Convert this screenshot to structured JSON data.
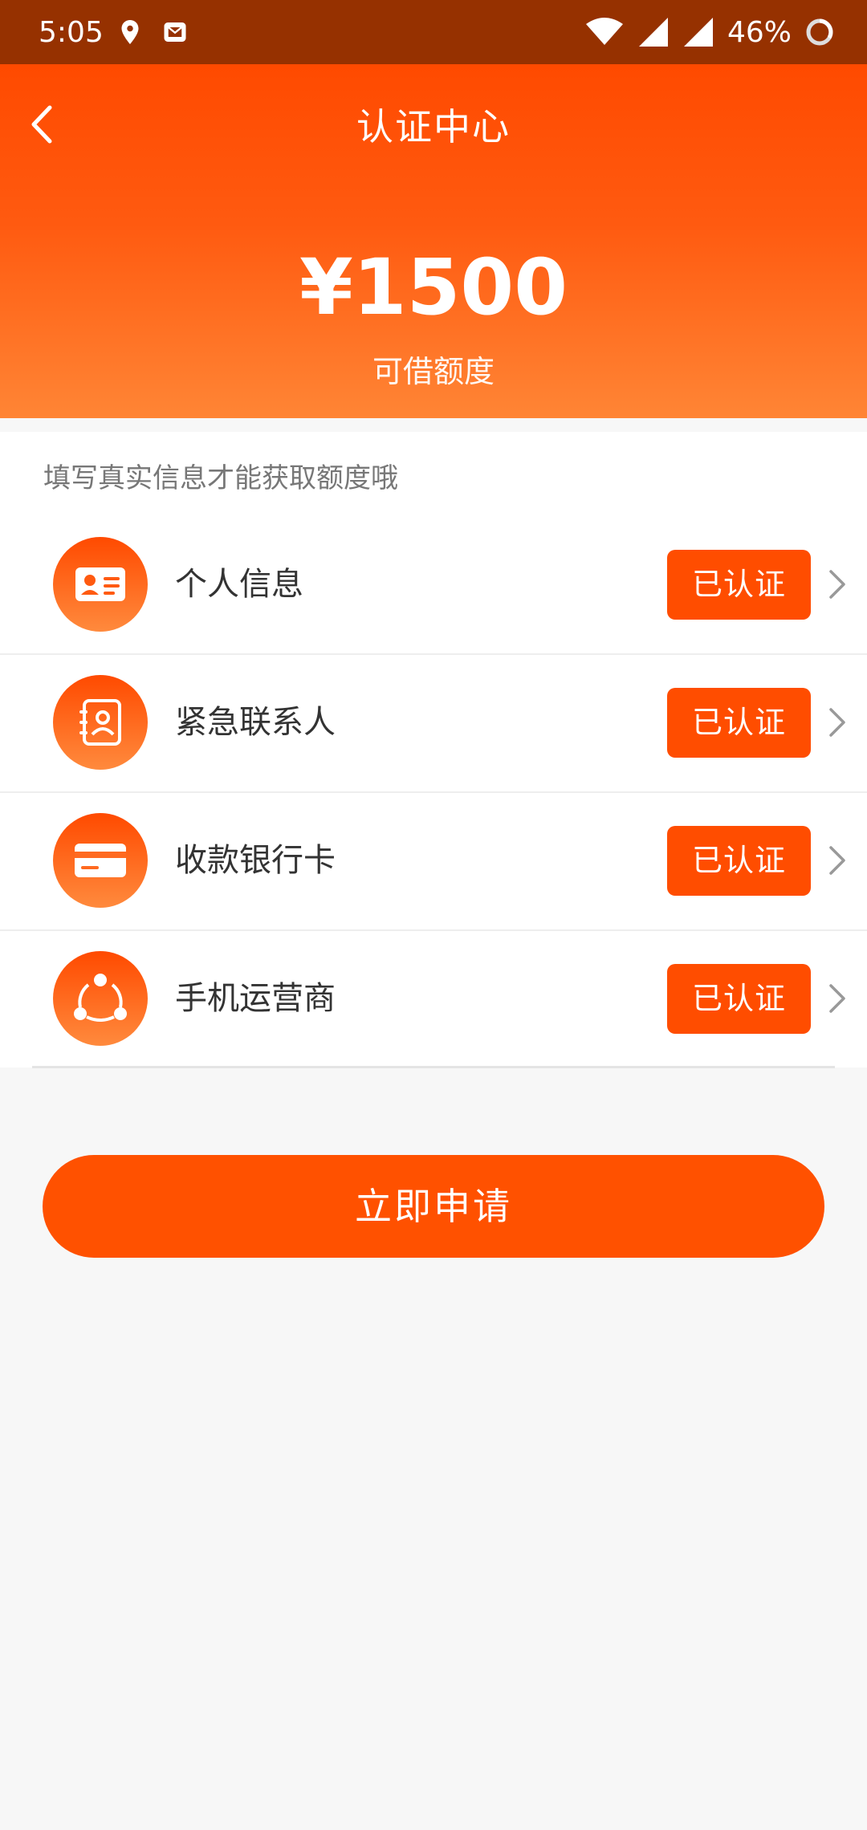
{
  "status_bar": {
    "time": "5:05",
    "battery": "46%",
    "icons": [
      "location-icon",
      "mail-icon",
      "wifi-icon",
      "signal-icon",
      "signal-icon",
      "battery-icon"
    ]
  },
  "header": {
    "title": "认证中心",
    "amount": "¥1500",
    "amount_label": "可借额度"
  },
  "card": {
    "hint": "填写真实信息才能获取额度哦",
    "items": [
      {
        "label": "个人信息",
        "status": "已认证",
        "icon": "id-card-icon"
      },
      {
        "label": "紧急联系人",
        "status": "已认证",
        "icon": "contact-icon"
      },
      {
        "label": "收款银行卡",
        "status": "已认证",
        "icon": "bank-card-icon"
      },
      {
        "label": "手机运营商",
        "status": "已认证",
        "icon": "network-icon"
      }
    ]
  },
  "apply_button": "立即申请",
  "colors": {
    "status_bar": "#963100",
    "accent": "#ff4d00",
    "background": "#f7f7f7"
  }
}
